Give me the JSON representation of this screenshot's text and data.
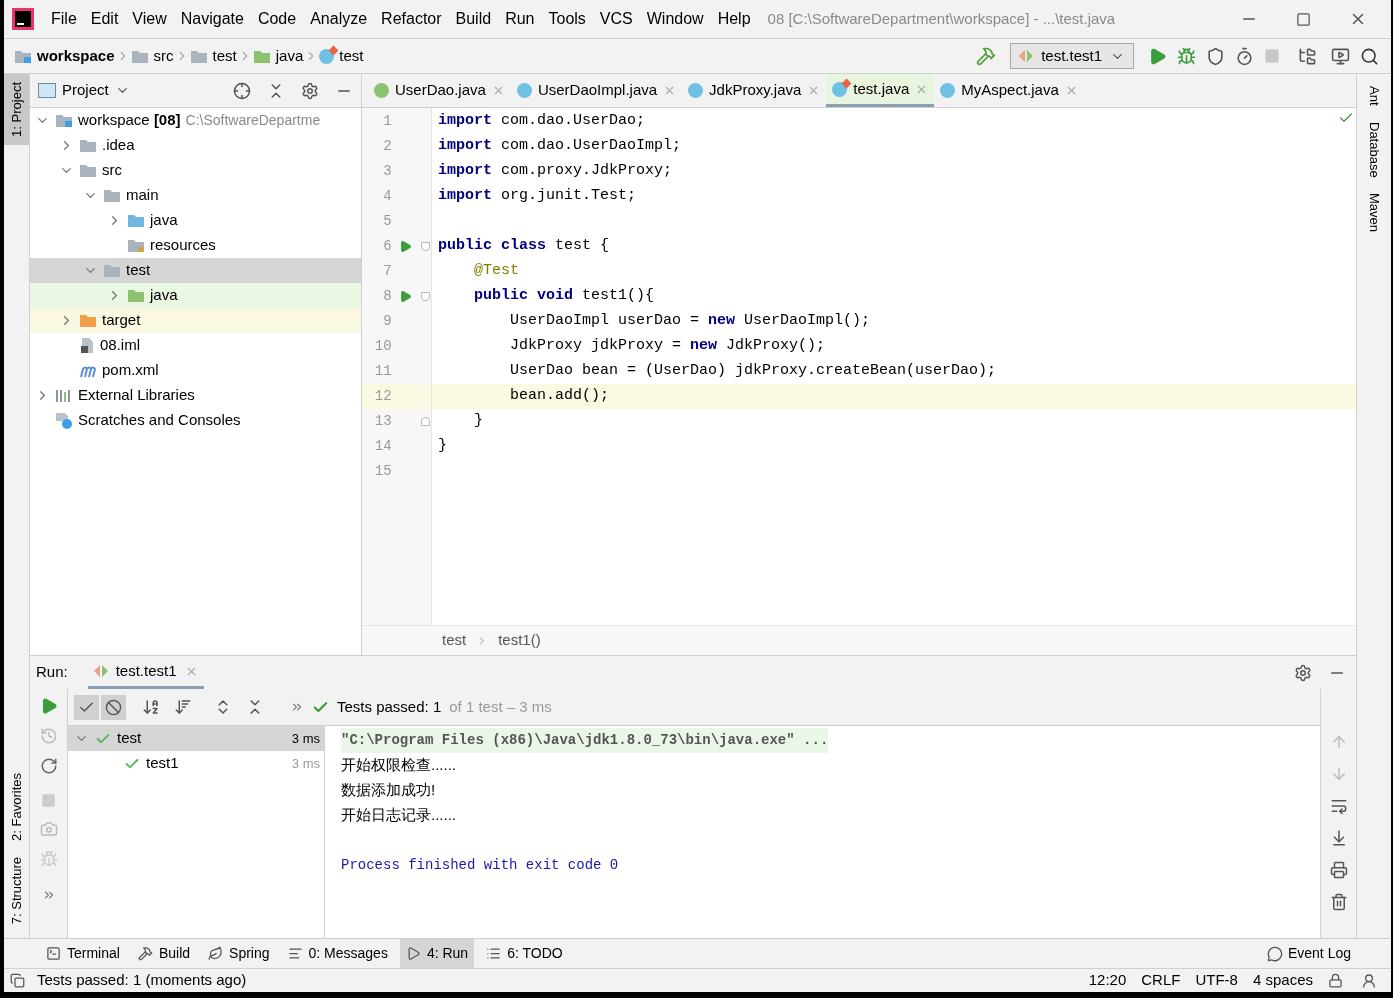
{
  "menu": [
    "File",
    "Edit",
    "View",
    "Navigate",
    "Code",
    "Analyze",
    "Refactor",
    "Build",
    "Run",
    "Tools",
    "VCS",
    "Window",
    "Help"
  ],
  "window": {
    "title": "08 [C:\\SoftwareDepartment\\workspace] - ...\\test.java"
  },
  "breadcrumbs": [
    {
      "label": "workspace",
      "kind": "module"
    },
    {
      "label": "src",
      "kind": "folder"
    },
    {
      "label": "test",
      "kind": "folder"
    },
    {
      "label": "java",
      "kind": "test-root"
    },
    {
      "label": "test",
      "kind": "test-class"
    }
  ],
  "run_config": "test.test1",
  "left_strip_top": [
    {
      "label": "1: Project",
      "selected": true
    }
  ],
  "left_strip_bottom": [
    {
      "label": "2: Favorites",
      "selected": false
    },
    {
      "label": "7: Structure",
      "selected": false
    }
  ],
  "right_strip": [
    {
      "label": "Ant"
    },
    {
      "label": "Database"
    },
    {
      "label": "Maven"
    }
  ],
  "project": {
    "title": "Project",
    "tree": [
      {
        "label": "workspace **[08]**",
        "path": "C:\\SoftwareDepartme",
        "kind": "module",
        "expanded": true,
        "selected": false,
        "children": [
          {
            "label": ".idea",
            "kind": "folder",
            "expanded": false,
            "selected": false
          },
          {
            "label": "src",
            "kind": "folder",
            "expanded": true,
            "selected": false,
            "children": [
              {
                "label": "main",
                "kind": "folder",
                "expanded": true,
                "selected": false,
                "children": [
                  {
                    "label": "java",
                    "kind": "source-root",
                    "expanded": false,
                    "selected": false
                  },
                  {
                    "label": "resources",
                    "kind": "resources-root",
                    "selected": false
                  }
                ]
              },
              {
                "label": "test",
                "kind": "folder",
                "expanded": true,
                "selected": true,
                "children": [
                  {
                    "label": "java",
                    "kind": "test-root",
                    "expanded": false,
                    "selected": false
                  }
                ]
              }
            ]
          },
          {
            "label": "target",
            "kind": "excluded",
            "expanded": false,
            "selected": false
          },
          {
            "label": "08.iml",
            "kind": "iml",
            "selected": false
          },
          {
            "label": "pom.xml",
            "kind": "maven",
            "selected": false
          }
        ]
      },
      {
        "label": "External Libraries",
        "kind": "libraries",
        "expanded": false,
        "selected": false
      },
      {
        "label": "Scratches and Consoles",
        "kind": "scratches",
        "selected": false
      }
    ]
  },
  "tabs": [
    {
      "label": "UserDao.java",
      "kind": "interface",
      "selected": false
    },
    {
      "label": "UserDaoImpl.java",
      "kind": "class",
      "selected": false
    },
    {
      "label": "JdkProxy.java",
      "kind": "class",
      "selected": false
    },
    {
      "label": "test.java",
      "kind": "test-class",
      "selected": true
    },
    {
      "label": "MyAspect.java",
      "kind": "class",
      "selected": false
    }
  ],
  "code": [
    {
      "number": "1",
      "current": false,
      "runnable": false,
      "fold_start": false,
      "fold_end": false,
      "tokens": [
        {
          "kind": "kw",
          "text": "import"
        },
        {
          "kind": "plain",
          "text": " com.dao.UserDao;"
        }
      ]
    },
    {
      "number": "2",
      "current": false,
      "runnable": false,
      "fold_start": false,
      "fold_end": false,
      "tokens": [
        {
          "kind": "kw",
          "text": "import"
        },
        {
          "kind": "plain",
          "text": " com.dao.UserDaoImpl;"
        }
      ]
    },
    {
      "number": "3",
      "current": false,
      "runnable": false,
      "fold_start": false,
      "fold_end": false,
      "tokens": [
        {
          "kind": "kw",
          "text": "import"
        },
        {
          "kind": "plain",
          "text": " com.proxy.JdkProxy;"
        }
      ]
    },
    {
      "number": "4",
      "current": false,
      "runnable": false,
      "fold_start": false,
      "fold_end": false,
      "tokens": [
        {
          "kind": "kw",
          "text": "import"
        },
        {
          "kind": "plain",
          "text": " org.junit.Test;"
        }
      ]
    },
    {
      "number": "5",
      "current": false,
      "runnable": false,
      "fold_start": false,
      "fold_end": false
    },
    {
      "number": "6",
      "current": false,
      "runnable": true,
      "fold_start": true,
      "fold_end": false,
      "tokens": [
        {
          "kind": "kw",
          "text": "public class"
        },
        {
          "kind": "plain",
          "text": " test {"
        }
      ]
    },
    {
      "number": "7",
      "current": false,
      "runnable": false,
      "fold_start": false,
      "fold_end": false,
      "tokens": [
        {
          "kind": "ann",
          "text": "    @Test"
        }
      ]
    },
    {
      "number": "8",
      "current": false,
      "runnable": true,
      "fold_start": true,
      "fold_end": false,
      "tokens": [
        {
          "kind": "kw",
          "text": "    public void"
        },
        {
          "kind": "plain",
          "text": " test1(){"
        }
      ]
    },
    {
      "number": "9",
      "current": false,
      "runnable": false,
      "fold_start": false,
      "fold_end": false,
      "tokens": [
        {
          "kind": "plain",
          "text": "        UserDaoImpl userDao = "
        },
        {
          "kind": "kw",
          "text": "new"
        },
        {
          "kind": "plain",
          "text": " UserDaoImpl();"
        }
      ]
    },
    {
      "number": "10",
      "current": false,
      "runnable": false,
      "fold_start": false,
      "fold_end": false,
      "tokens": [
        {
          "kind": "plain",
          "text": "        JdkProxy jdkProxy = "
        },
        {
          "kind": "kw",
          "text": "new"
        },
        {
          "kind": "plain",
          "text": " JdkProxy();"
        }
      ]
    },
    {
      "number": "11",
      "current": false,
      "runnable": false,
      "fold_start": false,
      "fold_end": false,
      "tokens": [
        {
          "kind": "plain",
          "text": "        UserDao bean = (UserDao) jdkProxy.createBean(userDao);"
        }
      ]
    },
    {
      "number": "12",
      "current": true,
      "runnable": false,
      "fold_start": false,
      "fold_end": false,
      "tokens": [
        {
          "kind": "plain",
          "text": "        bean.add();"
        }
      ]
    },
    {
      "number": "13",
      "current": false,
      "runnable": false,
      "fold_start": false,
      "fold_end": true,
      "tokens": [
        {
          "kind": "plain",
          "text": "    }"
        }
      ]
    },
    {
      "number": "14",
      "current": false,
      "runnable": false,
      "fold_start": false,
      "fold_end": false,
      "tokens": [
        {
          "kind": "plain",
          "text": "}"
        }
      ]
    },
    {
      "number": "15",
      "current": false,
      "runnable": false,
      "fold_start": false,
      "fold_end": false
    }
  ],
  "editor_breadcrumbs": [
    "test",
    "test1()"
  ],
  "run": {
    "label": "Run:",
    "tab": "test.test1",
    "status": "Tests passed: 1",
    "detail": "of 1 test – 3 ms",
    "tests": [
      {
        "label": "test",
        "time": "3 ms",
        "selected": true,
        "children": [
          {
            "label": "test1",
            "time": "3 ms",
            "selected": false
          }
        ]
      }
    ],
    "console": [
      {
        "kind": "command",
        "text": "\"C:\\Program Files (x86)\\Java\\jdk1.8.0_73\\bin\\java.exe\" ..."
      },
      {
        "kind": "output",
        "text": "开始权限检查......"
      },
      {
        "kind": "output",
        "text": "数据添加成功!"
      },
      {
        "kind": "output",
        "text": "开始日志记录......"
      },
      {
        "kind": "blank"
      },
      {
        "kind": "system",
        "text": "Process finished with exit code 0"
      }
    ]
  },
  "tool_windows": [
    {
      "label": "Terminal",
      "kind": "terminal",
      "selected": false
    },
    {
      "label": "Build",
      "kind": "build",
      "selected": false
    },
    {
      "label": "Spring",
      "kind": "spring",
      "selected": false
    },
    {
      "label": "0: Messages",
      "kind": "messages",
      "selected": false
    },
    {
      "label": "4: Run",
      "kind": "run",
      "selected": true
    },
    {
      "label": "6: TODO",
      "kind": "todo",
      "selected": false
    }
  ],
  "event_log": "Event Log",
  "status_bar": {
    "message": "Tests passed: 1 (moments ago)",
    "items": [
      "12:20",
      "CRLF",
      "UTF-8",
      "4 spaces"
    ]
  }
}
